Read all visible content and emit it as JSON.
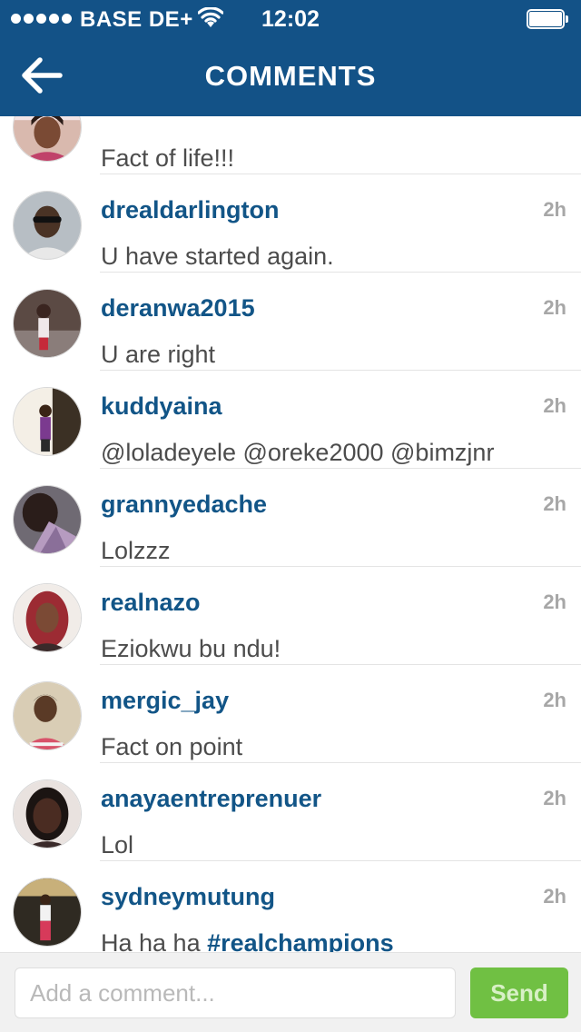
{
  "status_bar": {
    "carrier": "BASE DE+",
    "time": "12:02",
    "signal_icon": "signal-dots-icon",
    "wifi_icon": "wifi-icon",
    "battery_icon": "battery-icon"
  },
  "header": {
    "title": "COMMENTS",
    "back_icon": "back-arrow-icon",
    "background": "#135287"
  },
  "partial_comment": {
    "text": "Fact of life!!!"
  },
  "comments": [
    {
      "username": "drealdarlington",
      "text": "U have started again.",
      "time": "2h"
    },
    {
      "username": "deranwa2015",
      "text": "U are right",
      "time": "2h"
    },
    {
      "username": "kuddyaina",
      "text": "@loladeyele @oreke2000 @bimzjnr",
      "time": "2h"
    },
    {
      "username": "grannyedache",
      "text": "Lolzzz",
      "time": "2h"
    },
    {
      "username": "realnazo",
      "text": "Eziokwu bu ndu!",
      "time": "2h"
    },
    {
      "username": "mergic_jay",
      "text": "Fact on point",
      "time": "2h"
    },
    {
      "username": "anayaentreprenuer",
      "text": "Lol",
      "time": "2h"
    },
    {
      "username": "sydneymutung",
      "text_prefix": "Ha ha ha ",
      "text_tag": "#realchampions",
      "time": "2h"
    }
  ],
  "composer": {
    "placeholder": "Add a comment...",
    "send_label": "Send",
    "send_color": "#70c043"
  },
  "colors": {
    "username": "#125587",
    "comment_text": "#4c4c4c",
    "timestamp": "#a7a7a7"
  }
}
